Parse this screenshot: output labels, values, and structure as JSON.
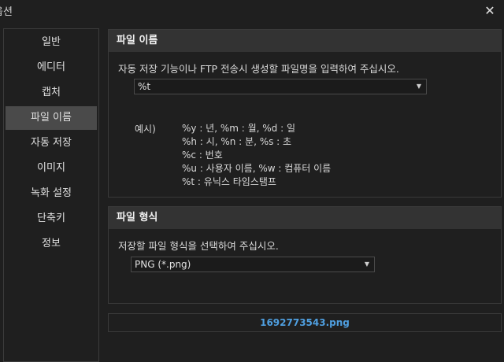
{
  "window": {
    "title": "옵션",
    "close_icon": "close-icon"
  },
  "sidebar": {
    "items": [
      {
        "label": "일반",
        "selected": false
      },
      {
        "label": "에디터",
        "selected": false
      },
      {
        "label": "캡처",
        "selected": false
      },
      {
        "label": "파일 이름",
        "selected": true
      },
      {
        "label": "자동 저장",
        "selected": false
      },
      {
        "label": "이미지",
        "selected": false
      },
      {
        "label": "녹화 설정",
        "selected": false
      },
      {
        "label": "단축키",
        "selected": false
      },
      {
        "label": "정보",
        "selected": false
      }
    ]
  },
  "filename_section": {
    "header": "파일 이름",
    "description": "자동 저장 기능이나 FTP 전송시 생성할 파일명을 입력하여 주십시오.",
    "pattern_value": "%t",
    "example_label": "예시)",
    "example_lines": [
      "%y : 년, %m : 월, %d : 일",
      "%h : 시, %n : 분, %s : 초",
      "%c : 번호",
      "%u : 사용자 이름, %w : 컴퓨터 이름",
      "%t : 유닉스 타임스탬프"
    ]
  },
  "format_section": {
    "header": "파일 형식",
    "description": "저장할 파일 형식을 선택하여 주십시오.",
    "selected_format": "PNG (*.png)"
  },
  "preview": {
    "filename": "1692773543.png"
  },
  "colors": {
    "accent": "#4f9fe0",
    "background": "#1f1f1f",
    "selected": "#4a4a4a"
  }
}
